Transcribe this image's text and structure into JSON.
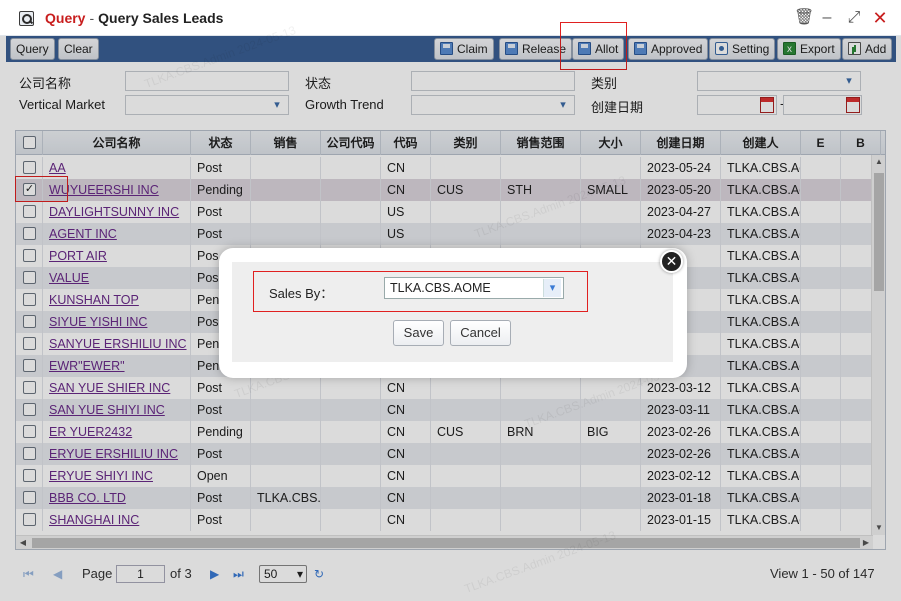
{
  "window": {
    "title_accent": "Query",
    "title_sep": "-",
    "title_text": "Query Sales Leads",
    "icons": [
      "search-icon",
      "trash-icon",
      "minimize-icon",
      "maximize-icon",
      "close-icon"
    ]
  },
  "toolbar": {
    "query": "Query",
    "clear": "Clear",
    "claim": "Claim",
    "release": "Release",
    "allot": "Allot",
    "approved": "Approved",
    "setting": "Setting",
    "export": "Export",
    "add": "Add"
  },
  "filters": {
    "company_name": "公司名称",
    "status": "状态",
    "category": "类别",
    "vertical_market": "Vertical Market",
    "growth_trend": "Growth Trend",
    "created_date": "创建日期",
    "date_sep": "-"
  },
  "grid": {
    "columns": [
      "公司名称",
      "状态",
      "销售",
      "公司代码",
      "代码",
      "类别",
      "销售范围",
      "大小",
      "创建日期",
      "创建人",
      "E",
      "B"
    ],
    "rows": [
      {
        "company": "AA",
        "status": "Post",
        "sales": "",
        "ccode": "",
        "code": "CN",
        "category": "",
        "range": "",
        "size": "",
        "date": "2023-05-24",
        "creator": "TLKA.CBS.Ac",
        "checked": false
      },
      {
        "company": "WUYUEERSHI INC",
        "status": "Pending",
        "sales": "",
        "ccode": "",
        "code": "CN",
        "category": "CUS",
        "range": "STH",
        "size": "SMALL",
        "date": "2023-05-20",
        "creator": "TLKA.CBS.Ac",
        "checked": true
      },
      {
        "company": "DAYLIGHTSUNNY INC",
        "status": "Post",
        "sales": "",
        "ccode": "",
        "code": "US",
        "category": "",
        "range": "",
        "size": "",
        "date": "2023-04-27",
        "creator": "TLKA.CBS.Ac",
        "checked": false
      },
      {
        "company": "AGENT INC",
        "status": "Post",
        "sales": "",
        "ccode": "",
        "code": "US",
        "category": "",
        "range": "",
        "size": "",
        "date": "2023-04-23",
        "creator": "TLKA.CBS.Ac",
        "checked": false
      },
      {
        "company": "PORT AIR",
        "status": "Pos",
        "sales": "",
        "ccode": "",
        "code": "",
        "category": "",
        "range": "",
        "size": "",
        "date": "4-17",
        "creator": "TLKA.CBS.Ac",
        "checked": false
      },
      {
        "company": "VALUE",
        "status": "Pos",
        "sales": "",
        "ccode": "",
        "code": "",
        "category": "",
        "range": "",
        "size": "",
        "date": "4-17",
        "creator": "TLKA.CBS.Ac",
        "checked": false
      },
      {
        "company": "KUNSHAN TOP",
        "status": "Pen",
        "sales": "",
        "ccode": "",
        "code": "",
        "category": "",
        "range": "",
        "size": "",
        "date": "4-17",
        "creator": "TLKA.CBS.Ac",
        "checked": false
      },
      {
        "company": "SIYUE YISHI INC",
        "status": "Pos",
        "sales": "",
        "ccode": "",
        "code": "",
        "category": "",
        "range": "",
        "size": "",
        "date": "4-10",
        "creator": "TLKA.CBS.Ac",
        "checked": false
      },
      {
        "company": "SANYUE ERSHILIU INC",
        "status": "Pen",
        "sales": "",
        "ccode": "",
        "code": "",
        "category": "",
        "range": "",
        "size": "",
        "date": "3-26",
        "creator": "TLKA.CBS.Ac",
        "checked": false
      },
      {
        "company": "EWR\"EWER\"",
        "status": "Pen",
        "sales": "",
        "ccode": "",
        "code": "",
        "category": "",
        "range": "",
        "size": "",
        "date": "3-14",
        "creator": "TLKA.CBS.Ac",
        "checked": false
      },
      {
        "company": "SAN YUE SHIER INC",
        "status": "Post",
        "sales": "",
        "ccode": "",
        "code": "CN",
        "category": "",
        "range": "",
        "size": "",
        "date": "2023-03-12",
        "creator": "TLKA.CBS.Ac",
        "checked": false
      },
      {
        "company": "SAN YUE SHIYI INC",
        "status": "Post",
        "sales": "",
        "ccode": "",
        "code": "CN",
        "category": "",
        "range": "",
        "size": "",
        "date": "2023-03-11",
        "creator": "TLKA.CBS.Ac",
        "checked": false
      },
      {
        "company": "ER YUER2432",
        "status": "Pending",
        "sales": "",
        "ccode": "",
        "code": "CN",
        "category": "CUS",
        "range": "BRN",
        "size": "BIG",
        "date": "2023-02-26",
        "creator": "TLKA.CBS.Ac",
        "checked": false
      },
      {
        "company": "ERYUE ERSHILIU INC",
        "status": "Post",
        "sales": "",
        "ccode": "",
        "code": "CN",
        "category": "",
        "range": "",
        "size": "",
        "date": "2023-02-26",
        "creator": "TLKA.CBS.Ac",
        "checked": false
      },
      {
        "company": "ERYUE SHIYI INC",
        "status": "Open",
        "sales": "",
        "ccode": "",
        "code": "CN",
        "category": "",
        "range": "",
        "size": "",
        "date": "2023-02-12",
        "creator": "TLKA.CBS.Ac",
        "checked": false
      },
      {
        "company": "BBB CO. LTD",
        "status": "Post",
        "sales": "TLKA.CBS./",
        "ccode": "",
        "code": "CN",
        "category": "",
        "range": "",
        "size": "",
        "date": "2023-01-18",
        "creator": "TLKA.CBS.Ac",
        "checked": false
      },
      {
        "company": "SHANGHAI INC",
        "status": "Post",
        "sales": "",
        "ccode": "",
        "code": "CN",
        "category": "",
        "range": "",
        "size": "",
        "date": "2023-01-15",
        "creator": "TLKA.CBS.Ac",
        "checked": false
      }
    ]
  },
  "pager": {
    "page_label": "Page",
    "page_value": "1",
    "of_label": "of 3",
    "page_size": "50",
    "view_text": "View 1 - 50 of 147"
  },
  "dialog": {
    "sales_by_label": "Sales By：",
    "sales_by_value": "TLKA.CBS.AOME",
    "save": "Save",
    "cancel": "Cancel"
  },
  "watermark": "TLKA.CBS.Admin 2024-05-13"
}
